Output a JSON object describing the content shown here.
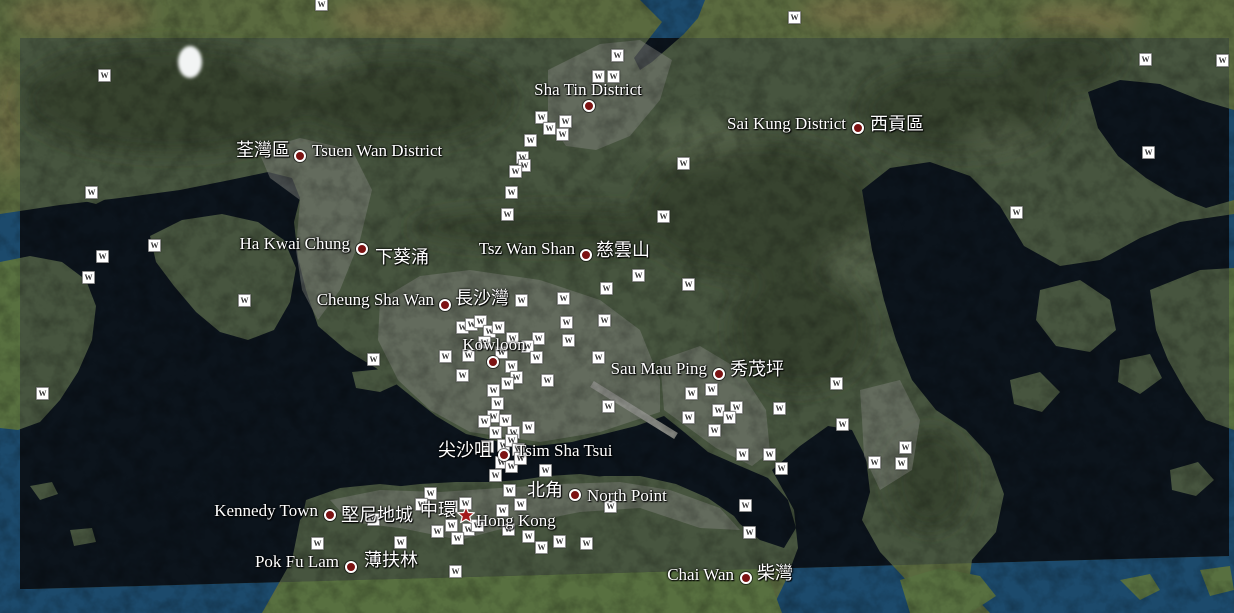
{
  "map": {
    "wiki_icon_glyph": "W",
    "colors": {
      "water": "#0c141c",
      "land": "#47553f",
      "placemark": "#7c1313",
      "star": "#a3191b",
      "label_text": "#ffffff",
      "wiki_icon": "#ffffff"
    }
  },
  "places": [
    {
      "en": "Sha Tin District",
      "marker_icon": "red-dot-icon"
    },
    {
      "en": "Sai Kung District",
      "zh": "西貢區",
      "marker_icon": "red-dot-icon"
    },
    {
      "en": "Tsuen Wan District",
      "zh": "荃灣區",
      "marker_icon": "red-dot-icon"
    },
    {
      "en": "Ha Kwai Chung",
      "zh": "下葵涌",
      "marker_icon": "red-dot-icon"
    },
    {
      "en": "Tsz Wan Shan",
      "zh": "慈雲山",
      "marker_icon": "red-dot-icon"
    },
    {
      "en": "Cheung Sha Wan",
      "zh": "長沙灣",
      "marker_icon": "red-dot-icon"
    },
    {
      "en": "Kowloon",
      "marker_icon": "red-dot-icon"
    },
    {
      "en": "Sau Mau Ping",
      "zh": "秀茂坪",
      "marker_icon": "red-dot-icon"
    },
    {
      "en": "Tsim Sha Tsui",
      "zh": "尖沙咀",
      "marker_icon": "red-dot-icon"
    },
    {
      "en": "North Point",
      "zh": "北角",
      "marker_icon": "red-dot-icon"
    },
    {
      "en": "Kennedy Town",
      "zh": "堅尼地城",
      "marker_icon": "red-dot-icon"
    },
    {
      "en": "Hong Kong",
      "zh": "中環",
      "marker_icon": "red-star-icon"
    },
    {
      "en": "Pok Fu Lam",
      "zh": "薄扶林",
      "marker_icon": "red-dot-icon"
    },
    {
      "en": "Chai Wan",
      "zh": "柴灣",
      "marker_icon": "red-dot-icon"
    }
  ]
}
